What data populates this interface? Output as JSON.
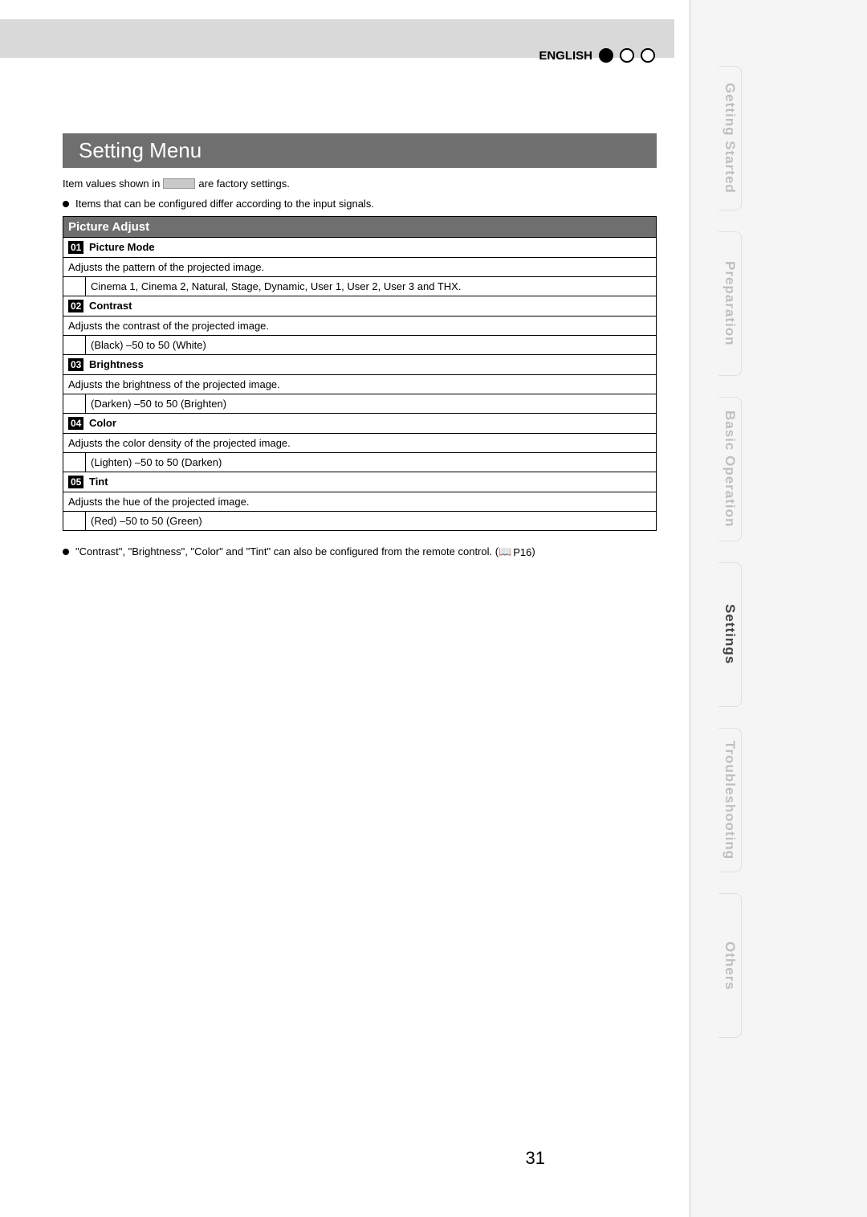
{
  "header": {
    "language": "ENGLISH"
  },
  "page": {
    "title": "Setting Menu",
    "factory_note_pre": "Item values shown in",
    "factory_note_post": "are factory settings.",
    "input_note": "Items that can be configured differ according to the input signals.",
    "footnote_text": "\"Contrast\", \"Brightness\", \"Color\" and \"Tint\" can also be configured from the remote control. (",
    "footnote_ref": "P16",
    "footnote_close": ")",
    "number": "31"
  },
  "section": {
    "title": "Picture Adjust",
    "items": [
      {
        "num": "01",
        "name": "Picture Mode",
        "desc": "Adjusts the pattern of the projected image.",
        "values": "Cinema 1, Cinema 2, Natural, Stage, Dynamic, User 1, User 2, User 3 and THX."
      },
      {
        "num": "02",
        "name": "Contrast",
        "desc": "Adjusts the contrast of the projected image.",
        "values": "(Black) –50 to 50 (White)"
      },
      {
        "num": "03",
        "name": "Brightness",
        "desc": "Adjusts the brightness of the projected image.",
        "values": "(Darken) –50 to 50 (Brighten)"
      },
      {
        "num": "04",
        "name": "Color",
        "desc": "Adjusts the color density of the projected image.",
        "values": "(Lighten) –50 to 50 (Darken)"
      },
      {
        "num": "05",
        "name": "Tint",
        "desc": "Adjusts the hue of the projected image.",
        "values": "(Red) –50 to 50 (Green)"
      }
    ]
  },
  "tabs": [
    "Getting Started",
    "Preparation",
    "Basic Operation",
    "Settings",
    "Troubleshooting",
    "Others"
  ],
  "tabs_active_index": 3
}
